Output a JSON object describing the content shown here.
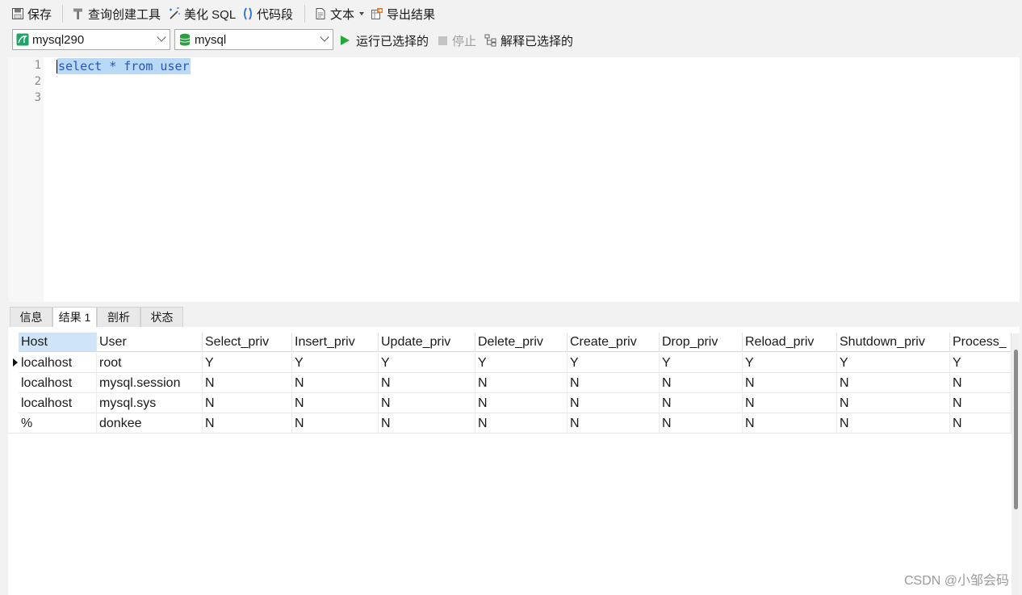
{
  "toolbar": {
    "save": "保存",
    "query_builder": "查询创建工具",
    "beautify": "美化 SQL",
    "snippet": "代码段",
    "text": "文本",
    "export": "导出结果"
  },
  "connection": {
    "server": "mysql290",
    "database": "mysql",
    "run_selected": "运行已选择的",
    "stop": "停止",
    "explain_selected": "解释已选择的"
  },
  "editor": {
    "line_numbers": [
      "1",
      "2",
      "3"
    ],
    "lines": [
      "select * from user",
      "",
      ""
    ]
  },
  "tabs": [
    {
      "label": "信息",
      "active": false
    },
    {
      "label": "结果 1",
      "active": true
    },
    {
      "label": "剖析",
      "active": false
    },
    {
      "label": "状态",
      "active": false
    }
  ],
  "grid": {
    "columns": [
      "Host",
      "User",
      "Select_priv",
      "Insert_priv",
      "Update_priv",
      "Delete_priv",
      "Create_priv",
      "Drop_priv",
      "Reload_priv",
      "Shutdown_priv",
      "Process_"
    ],
    "rows": [
      [
        "localhost",
        "root",
        "Y",
        "Y",
        "Y",
        "Y",
        "Y",
        "Y",
        "Y",
        "Y",
        "Y"
      ],
      [
        "localhost",
        "mysql.session",
        "N",
        "N",
        "N",
        "N",
        "N",
        "N",
        "N",
        "N",
        "N"
      ],
      [
        "localhost",
        "mysql.sys",
        "N",
        "N",
        "N",
        "N",
        "N",
        "N",
        "N",
        "N",
        "N"
      ],
      [
        "%",
        "donkee",
        "N",
        "N",
        "N",
        "N",
        "N",
        "N",
        "N",
        "N",
        "N"
      ]
    ]
  },
  "watermark": "CSDN @小邹会码",
  "colors": {
    "accent": "#2a55b8",
    "selection": "#b9d9f5",
    "run": "#22a83a",
    "db": "#2f9e44"
  }
}
